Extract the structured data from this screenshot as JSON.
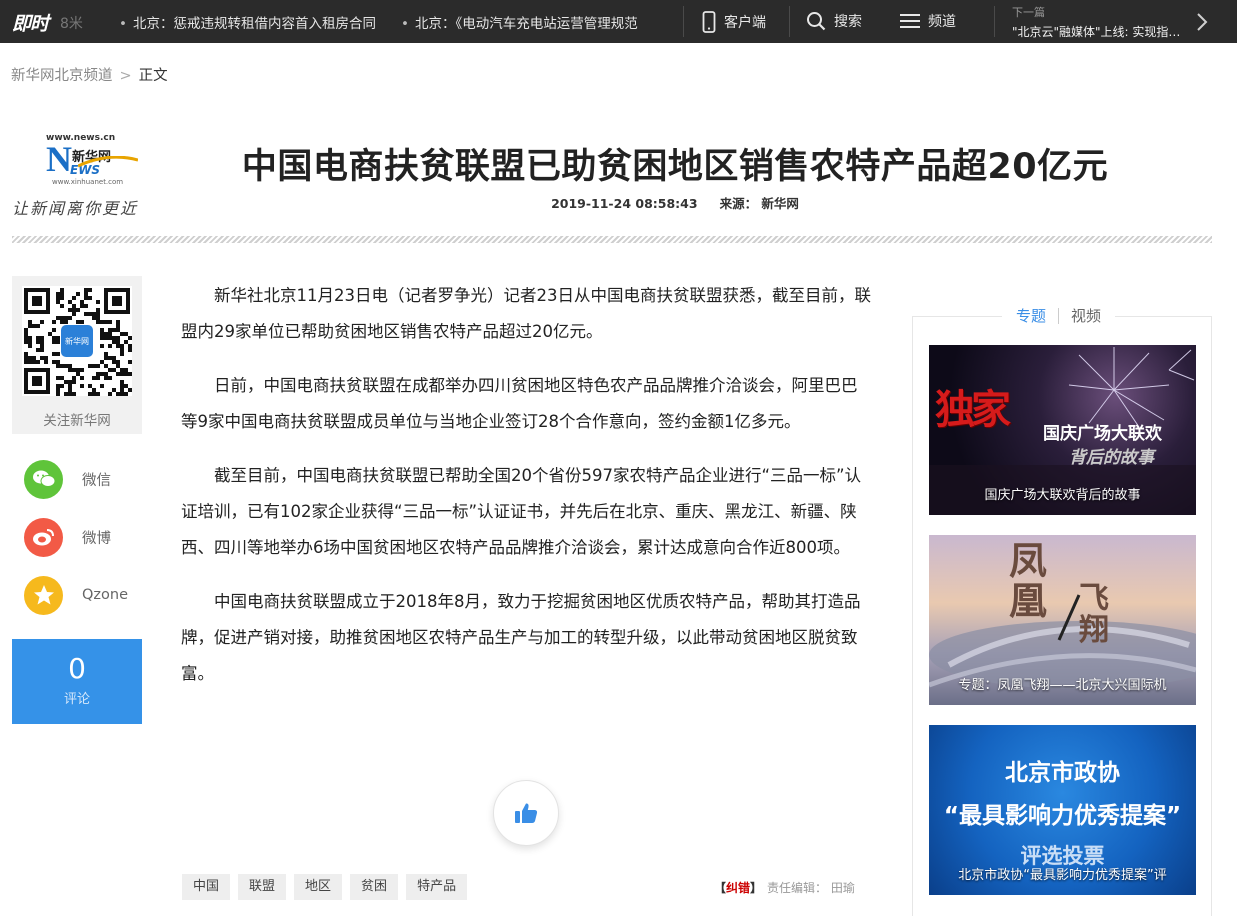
{
  "topbar": {
    "logo": "即时",
    "ticker_fade": "8米",
    "ticker": [
      "北京：惩戒违规转租借内容首入租房合同",
      "北京：《电动汽车充电站运营管理规范"
    ],
    "client_label": "客户端",
    "search_label": "搜索",
    "channel_label": "频道",
    "next_label": "下一篇",
    "next_title": "\"北京云\"融媒体\"上线: 实现指尖上的北京"
  },
  "breadcrumb": {
    "home": "新华网北京频道",
    "separator": ">",
    "current": "正文"
  },
  "site_logo": {
    "url_top": "www.news.cn",
    "letter": "N",
    "name": "新华网",
    "ews": "EWS",
    "url_bottom": "www.xinhuanet.com",
    "slogan": "让新闻离你更近"
  },
  "article": {
    "title": "中国电商扶贫联盟已助贫困地区销售农特产品超20亿元",
    "datetime": "2019-11-24 08:58:43",
    "source": "来源： 新华网",
    "paragraphs": [
      "新华社北京11月23日电（记者罗争光）记者23日从中国电商扶贫联盟获悉，截至目前，联盟内29家单位已帮助贫困地区销售农特产品超过20亿元。",
      "日前，中国电商扶贫联盟在成都举办四川贫困地区特色农产品品牌推介洽谈会，阿里巴巴等9家中国电商扶贫联盟成员单位与当地企业签订28个合作意向，签约金额1亿多元。",
      "截至目前，中国电商扶贫联盟已帮助全国20个省份597家农特产品企业进行“三品一标”认证培训，已有102家企业获得“三品一标”认证证书，并先后在北京、重庆、黑龙江、新疆、陕西、四川等地举办6场中国贫困地区农特产品品牌推介洽谈会，累计达成意向合作近800项。",
      "中国电商扶贫联盟成立于2018年8月，致力于挖掘贫困地区优质农特产品，帮助其打造品牌，促进产销对接，助推贫困地区农特产品生产与加工的转型升级，以此带动贫困地区脱贫致富。"
    ],
    "tags": [
      "中国",
      "联盟",
      "地区",
      "贫困",
      "特产品"
    ],
    "error_label": "纠错",
    "editor": "责任编辑： 田瑜"
  },
  "share": {
    "qr_label": "关注新华网",
    "qr_center": "新华网",
    "wechat": "微信",
    "weibo": "微博",
    "qzone": "Qzone",
    "comment_count": "0",
    "comment_label": "评论"
  },
  "sidebar": {
    "tab_topics": "专题",
    "tab_video": "视频",
    "promos": [
      {
        "overlay_big": "独家",
        "overlay_line1": "国庆广场大联欢",
        "overlay_line2": "背后的故事",
        "caption": "国庆广场大联欢背后的故事"
      },
      {
        "overlay_big1": "凤凰",
        "overlay_big2": "飞翔",
        "caption": "专题：凤凰飞翔——北京大兴国际机"
      },
      {
        "overlay_line1": "北京市政协",
        "overlay_line2": "“最具影响力优秀提案”",
        "overlay_line3": "评选投票",
        "caption": "北京市政协“最具影响力优秀提案”评"
      }
    ]
  },
  "colors": {
    "topbar_bg": "#2b2b2b",
    "accent_blue": "#3592e8",
    "wechat_green": "#5fc43a",
    "weibo_red": "#f25a46",
    "qzone_yellow": "#f6b91d"
  }
}
